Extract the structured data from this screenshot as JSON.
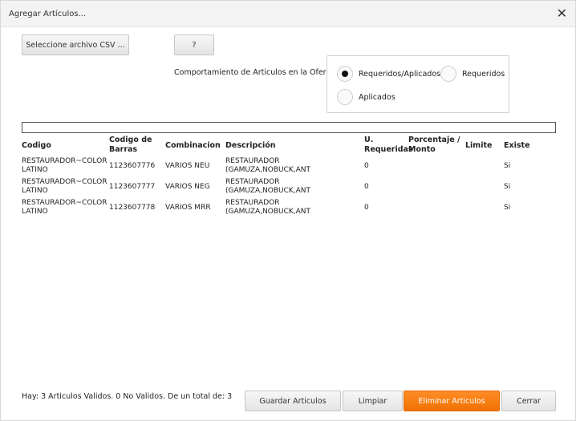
{
  "dialog": {
    "title": "Agregar Artículos...",
    "close_symbol": "✕"
  },
  "toolbar": {
    "select_csv_label": "Seleccione archivo CSV ...",
    "help_label": "?"
  },
  "behavior": {
    "label": "Comportamiento de Articulos en la Oferta:",
    "options": [
      {
        "label": "Requeridos/Aplicados",
        "selected": true
      },
      {
        "label": "Requeridos",
        "selected": false
      },
      {
        "label": "Aplicados",
        "selected": false
      }
    ]
  },
  "table": {
    "headers": {
      "codigo": "Codigo",
      "codigo_barras_1": "Codigo de",
      "codigo_barras_2": "Barras",
      "combinacion": "Combinacion",
      "descripcion": "Descripción",
      "u_requeridas_1": "U.",
      "u_requeridas_2": "Requeridas",
      "porcentaje_1": "Porcentaje /",
      "porcentaje_2": "Monto",
      "limite": "Limite",
      "existe": "Existe"
    },
    "rows": [
      {
        "codigo_1": "RESTAURADOR~COLOR",
        "codigo_2": "LATINO",
        "barras": "1123607776",
        "combinacion": "VARIOS NEU",
        "descripcion_1": "RESTAURADOR",
        "descripcion_2": "(GAMUZA,NOBUCK,ANT",
        "u_requeridas": "0",
        "porcentaje": "",
        "limite": "",
        "existe": "Si"
      },
      {
        "codigo_1": "RESTAURADOR~COLOR",
        "codigo_2": "LATINO",
        "barras": "1123607777",
        "combinacion": "VARIOS NEG",
        "descripcion_1": "RESTAURADOR",
        "descripcion_2": "(GAMUZA,NOBUCK,ANT",
        "u_requeridas": "0",
        "porcentaje": "",
        "limite": "",
        "existe": "Si"
      },
      {
        "codigo_1": "RESTAURADOR~COLOR",
        "codigo_2": "LATINO",
        "barras": "1123607778",
        "combinacion": "VARIOS MRR",
        "descripcion_1": "RESTAURADOR",
        "descripcion_2": "(GAMUZA,NOBUCK,ANT",
        "u_requeridas": "0",
        "porcentaje": "",
        "limite": "",
        "existe": "Si"
      }
    ]
  },
  "footer": {
    "summary": "Hay: 3 Articulos Validos. 0 No Validos. De un total de: 3",
    "save_label": "Guardar Articulos",
    "clear_label": "Limpiar",
    "delete_label": "Eliminar Articulos",
    "close_label": "Cerrar"
  },
  "colors": {
    "accent_orange": "#f07100"
  }
}
